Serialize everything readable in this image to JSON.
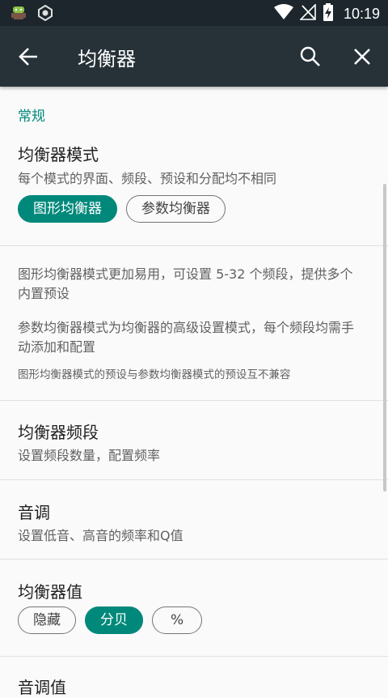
{
  "statusbar": {
    "time": "10:19",
    "icons": [
      "android-debug-icon",
      "app-notification-icon",
      "wifi-icon",
      "no-signal-icon",
      "battery-charging-icon"
    ]
  },
  "toolbar": {
    "title": "均衡器",
    "back_icon": "arrow-back-icon",
    "search_icon": "search-icon",
    "close_icon": "close-icon"
  },
  "general": {
    "header": "常规",
    "mode": {
      "title": "均衡器模式",
      "summary": "每个模式的界面、频段、预设和分配均不相同",
      "options": [
        "图形均衡器",
        "参数均衡器"
      ],
      "selected": "图形均衡器"
    },
    "info": {
      "graphic": "图形均衡器模式更加易用，可设置 5-32 个频段，提供多个内置预设",
      "parametric": "参数均衡器模式为均衡器的高级设置模式，每个频段均需手动添加和配置",
      "note": "图形均衡器模式的预设与参数均衡器模式的预设互不兼容"
    },
    "bands": {
      "title": "均衡器频段",
      "summary": "设置频段数量，配置频率"
    },
    "tone": {
      "title": "音调",
      "summary": "设置低音、高音的频率和Q值"
    },
    "values": {
      "title": "均衡器值",
      "options": [
        "隐藏",
        "分贝",
        "%"
      ],
      "selected": "分贝"
    },
    "tone_values": {
      "title": "音调值"
    }
  },
  "colors": {
    "accent": "#00897b",
    "toolbar": "#263238",
    "statusbar": "#1c262c"
  }
}
